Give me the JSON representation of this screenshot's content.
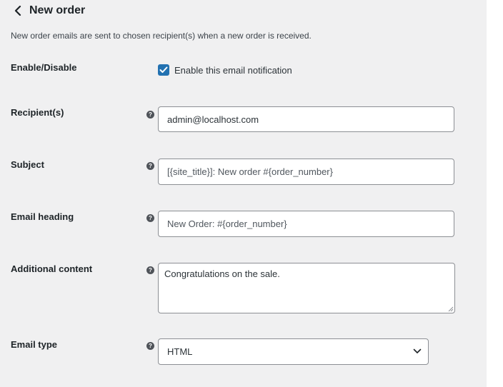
{
  "header": {
    "title": "New order"
  },
  "description": "New order emails are sent to chosen recipient(s) when a new order is received.",
  "fields": {
    "enable": {
      "label": "Enable/Disable",
      "checkbox_label": "Enable this email notification",
      "checked": true
    },
    "recipient": {
      "label": "Recipient(s)",
      "value": "admin@localhost.com"
    },
    "subject": {
      "label": "Subject",
      "placeholder": "[{site_title}]: New order #{order_number}"
    },
    "email_heading": {
      "label": "Email heading",
      "placeholder": "New Order: #{order_number}"
    },
    "additional_content": {
      "label": "Additional content",
      "value": "Congratulations on the sale."
    },
    "email_type": {
      "label": "Email type",
      "selected": "HTML"
    }
  },
  "help_icon_glyph": "?",
  "colors": {
    "checkbox_accent": "#2271b1",
    "panel_bg": "#f0f0f1"
  }
}
